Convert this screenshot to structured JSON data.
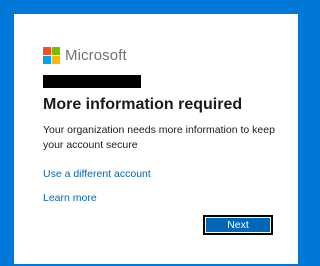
{
  "brand": {
    "name": "Microsoft",
    "colors": {
      "red": "#f25022",
      "green": "#7fba00",
      "blue": "#00a4ef",
      "yellow": "#ffb900"
    }
  },
  "dialog": {
    "title": "More information required",
    "description": "Your organization needs more information to keep your account secure",
    "links": {
      "use_different_account": "Use a different account",
      "learn_more": "Learn more"
    },
    "next_label": "Next"
  },
  "theme": {
    "accent": "#0078d7",
    "link_color": "#0067b8",
    "button_color": "#0067b8"
  }
}
